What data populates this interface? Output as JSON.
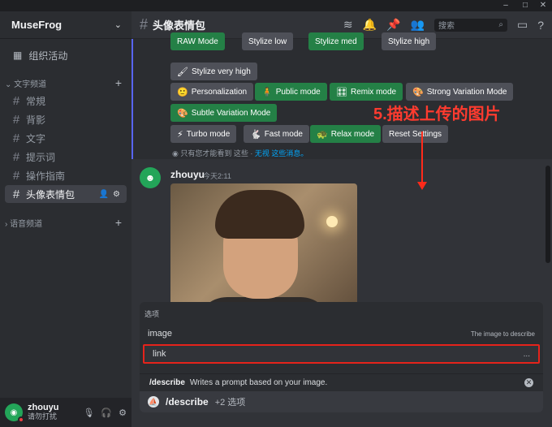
{
  "window": {
    "minimize": "–",
    "maximize": "□",
    "close": "✕"
  },
  "server": {
    "name": "MuseFrog",
    "events_label": "组织活动"
  },
  "sidebar": {
    "text_category": "文字频道",
    "voice_category": "语音频道",
    "channels": [
      {
        "name": "常規"
      },
      {
        "name": "背影"
      },
      {
        "name": "文字"
      },
      {
        "name": "提示词"
      },
      {
        "name": "操作指南"
      },
      {
        "name": "头像表情包",
        "active": true
      }
    ]
  },
  "user": {
    "name": "zhouyu",
    "status": "请勿打扰"
  },
  "channel_header": {
    "title": "头像表情包",
    "search_placeholder": "搜索"
  },
  "embed": {
    "buttons_row0": [
      "RAW Mode",
      "Stylize low",
      "Stylize med",
      "Stylize high"
    ],
    "buttons": [
      {
        "label": "Stylize very high",
        "color": "gray",
        "icon": "🖌"
      },
      {
        "label": "Personalization",
        "color": "gray",
        "icon": "🙂"
      },
      {
        "label": "Public mode",
        "color": "green",
        "icon": "🧍"
      },
      {
        "label": "Remix mode",
        "color": "green",
        "icon": "🎛"
      },
      {
        "label": "Strong Variation Mode",
        "color": "gray",
        "icon": "🎨"
      },
      {
        "label": "Subtle Variation Mode",
        "color": "green",
        "icon": "🎨"
      },
      {
        "label": "Turbo mode",
        "color": "gray",
        "icon": "⚡"
      },
      {
        "label": "Fast mode",
        "color": "gray",
        "icon": "🐇"
      },
      {
        "label": "Relax mode",
        "color": "green",
        "icon": "🐢"
      },
      {
        "label": "Reset Settings",
        "color": "gray",
        "icon": ""
      }
    ],
    "ephemeral_text": "只有您才能看到 这些 ·",
    "ephemeral_link": "无视 这些消息。"
  },
  "message": {
    "author": "zhouyu",
    "time": "今天2:11"
  },
  "annotation": "5.描述上传的图片",
  "options": {
    "title": "选项",
    "image_label": "image",
    "image_desc": "The image to describe",
    "link_label": "link",
    "link_more": "..."
  },
  "command": {
    "name": "/describe",
    "desc": "Writes a prompt based on your image.",
    "input_cmd": "/describe",
    "input_more": "+2 选项"
  },
  "icons": {
    "close_x": "✕"
  }
}
